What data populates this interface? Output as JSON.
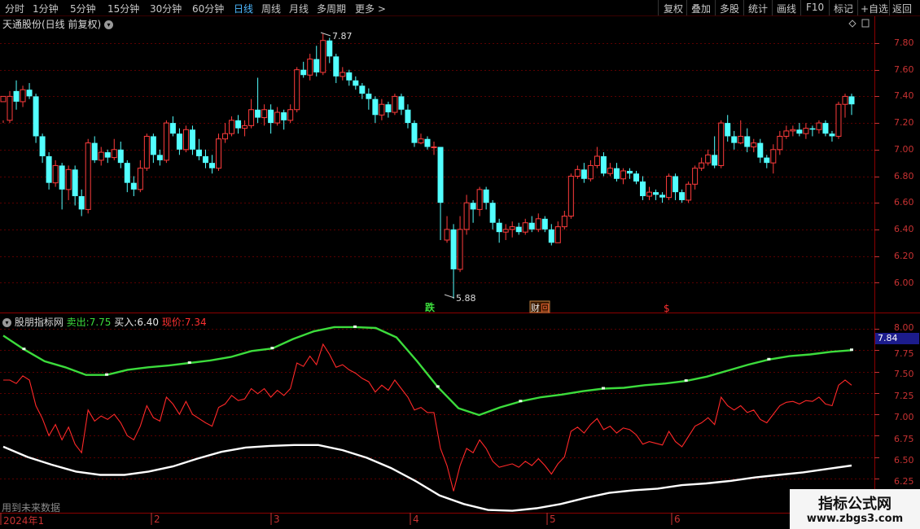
{
  "toolbar": {
    "periods": [
      "分时",
      "1分钟",
      "5分钟",
      "15分钟",
      "30分钟",
      "60分钟",
      "日线",
      "周线",
      "月线",
      "多周期",
      "更多"
    ],
    "active_period": "日线",
    "more_arrow": ">",
    "right_buttons": [
      "复权",
      "叠加",
      "多股",
      "统计",
      "画线",
      "F10",
      "标记",
      "+自选",
      "返回"
    ]
  },
  "chart": {
    "title": "天通股份(日线 前复权)",
    "high_mark": "7.87",
    "low_mark": "5.88",
    "event_labels": [
      "跌",
      "财",
      "回",
      "$"
    ],
    "price_ticks": [
      "7.80",
      "7.60",
      "7.40",
      "7.20",
      "7.00",
      "6.80",
      "6.60",
      "6.40",
      "6.20",
      "6.00"
    ]
  },
  "indicator": {
    "name": "股朋指标网",
    "sell_label": "卖出:",
    "sell_value": "7.75",
    "buy_label": "买入:",
    "buy_value": "6.40",
    "price_label": "现价:",
    "price_value": "7.34",
    "current_box": "7.84",
    "ticks": [
      "8.00",
      "7.75",
      "7.50",
      "7.25",
      "7.00",
      "6.75",
      "6.50",
      "6.25"
    ]
  },
  "date_axis": [
    "2024年1",
    "2",
    "3",
    "4",
    "5",
    "6"
  ],
  "footer_note": "用到未来数据",
  "watermark": {
    "title": "指标公式网",
    "url": "www.zbgs3.com"
  },
  "colors": {
    "up": "#ff3c3c",
    "down": "#52ffff",
    "sell_line": "#3cdc3c",
    "buy_line": "#ffffff",
    "price_line": "#ff2828",
    "active": "#4db8ff"
  },
  "chart_data": {
    "type": "candlestick",
    "price_range": [
      5.88,
      7.87
    ],
    "candles": [
      [
        7.36,
        7.4,
        7.22,
        7.2
      ],
      [
        7.22,
        7.4,
        7.44,
        7.2
      ],
      [
        7.44,
        7.36,
        7.52,
        7.3
      ],
      [
        7.36,
        7.45,
        7.48,
        7.32
      ],
      [
        7.45,
        7.4,
        7.5,
        7.38
      ],
      [
        7.4,
        7.1,
        7.42,
        7.05
      ],
      [
        7.1,
        6.95,
        7.12,
        6.9
      ],
      [
        6.95,
        6.75,
        6.98,
        6.7
      ],
      [
        6.75,
        6.88,
        6.92,
        6.72
      ],
      [
        6.88,
        6.7,
        6.9,
        6.55
      ],
      [
        6.7,
        6.85,
        6.88,
        6.62
      ],
      [
        6.85,
        6.65,
        6.88,
        6.58
      ],
      [
        6.65,
        6.55,
        6.7,
        6.5
      ],
      [
        6.55,
        7.05,
        7.08,
        6.52
      ],
      [
        7.05,
        6.92,
        7.1,
        6.9
      ],
      [
        6.92,
        6.98,
        7.02,
        6.88
      ],
      [
        6.98,
        6.94,
        7.0,
        6.9
      ],
      [
        6.94,
        7.0,
        7.08,
        6.92
      ],
      [
        7.0,
        6.9,
        7.06,
        6.86
      ],
      [
        6.9,
        6.75,
        6.92,
        6.68
      ],
      [
        6.75,
        6.7,
        6.8,
        6.65
      ],
      [
        6.7,
        6.86,
        6.92,
        6.68
      ],
      [
        6.86,
        7.1,
        7.12,
        6.84
      ],
      [
        7.1,
        6.96,
        7.12,
        6.9
      ],
      [
        6.96,
        6.92,
        7.0,
        6.88
      ],
      [
        6.92,
        7.2,
        7.22,
        6.9
      ],
      [
        7.2,
        7.12,
        7.25,
        7.1
      ],
      [
        7.12,
        7.0,
        7.16,
        6.96
      ],
      [
        7.0,
        7.15,
        7.18,
        6.98
      ],
      [
        7.15,
        7.0,
        7.18,
        6.96
      ],
      [
        7.0,
        6.95,
        7.08,
        6.92
      ],
      [
        6.95,
        6.9,
        7.0,
        6.86
      ],
      [
        6.9,
        6.86,
        6.96,
        6.82
      ],
      [
        6.86,
        7.08,
        7.12,
        6.84
      ],
      [
        7.08,
        7.12,
        7.2,
        7.05
      ],
      [
        7.12,
        7.22,
        7.25,
        7.1
      ],
      [
        7.22,
        7.16,
        7.26,
        7.12
      ],
      [
        7.16,
        7.18,
        7.22,
        7.1
      ],
      [
        7.18,
        7.3,
        7.38,
        7.16
      ],
      [
        7.3,
        7.24,
        7.54,
        7.2
      ],
      [
        7.24,
        7.3,
        7.34,
        7.18
      ],
      [
        7.3,
        7.2,
        7.34,
        7.12
      ],
      [
        7.2,
        7.28,
        7.32,
        7.18
      ],
      [
        7.28,
        7.22,
        7.3,
        7.15
      ],
      [
        7.22,
        7.3,
        7.34,
        7.2
      ],
      [
        7.3,
        7.6,
        7.62,
        7.28
      ],
      [
        7.6,
        7.56,
        7.66,
        7.54
      ],
      [
        7.56,
        7.68,
        7.72,
        7.52
      ],
      [
        7.68,
        7.58,
        7.78,
        7.55
      ],
      [
        7.58,
        7.82,
        7.87,
        7.56
      ],
      [
        7.82,
        7.7,
        7.84,
        7.65
      ],
      [
        7.7,
        7.55,
        7.72,
        7.5
      ],
      [
        7.55,
        7.58,
        7.62,
        7.52
      ],
      [
        7.58,
        7.52,
        7.6,
        7.48
      ],
      [
        7.52,
        7.48,
        7.55,
        7.45
      ],
      [
        7.48,
        7.42,
        7.5,
        7.38
      ],
      [
        7.42,
        7.38,
        7.46,
        7.3
      ],
      [
        7.38,
        7.26,
        7.4,
        7.2
      ],
      [
        7.26,
        7.34,
        7.38,
        7.22
      ],
      [
        7.34,
        7.28,
        7.36,
        7.24
      ],
      [
        7.28,
        7.4,
        7.42,
        7.26
      ],
      [
        7.4,
        7.3,
        7.42,
        7.26
      ],
      [
        7.3,
        7.2,
        7.34,
        7.16
      ],
      [
        7.2,
        7.05,
        7.22,
        7.02
      ],
      [
        7.05,
        7.08,
        7.12,
        7.04
      ],
      [
        7.08,
        7.02,
        7.1,
        7.0
      ],
      [
        7.02,
        7.02,
        7.06,
        6.96
      ],
      [
        7.02,
        6.6,
        6.72,
        6.32
      ],
      [
        6.32,
        6.4,
        6.5,
        6.3
      ],
      [
        6.4,
        6.1,
        6.44,
        5.88
      ],
      [
        6.1,
        6.4,
        6.5,
        6.08
      ],
      [
        6.4,
        6.6,
        6.66,
        6.36
      ],
      [
        6.6,
        6.55,
        6.62,
        6.45
      ],
      [
        6.55,
        6.7,
        6.72,
        6.5
      ],
      [
        6.7,
        6.6,
        6.72,
        6.55
      ],
      [
        6.6,
        6.45,
        6.62,
        6.4
      ],
      [
        6.45,
        6.38,
        6.48,
        6.3
      ],
      [
        6.38,
        6.4,
        6.44,
        6.32
      ],
      [
        6.4,
        6.42,
        6.46,
        6.34
      ],
      [
        6.42,
        6.38,
        6.45,
        6.36
      ],
      [
        6.38,
        6.45,
        6.48,
        6.36
      ],
      [
        6.45,
        6.4,
        6.5,
        6.38
      ],
      [
        6.4,
        6.48,
        6.52,
        6.38
      ],
      [
        6.48,
        6.4,
        6.5,
        6.38
      ],
      [
        6.4,
        6.3,
        6.44,
        6.28
      ],
      [
        6.3,
        6.42,
        6.46,
        6.3
      ],
      [
        6.42,
        6.5,
        6.54,
        6.4
      ],
      [
        6.5,
        6.8,
        6.82,
        6.48
      ],
      [
        6.8,
        6.85,
        6.88,
        6.78
      ],
      [
        6.85,
        6.78,
        6.9,
        6.75
      ],
      [
        6.78,
        6.88,
        6.92,
        6.76
      ],
      [
        6.88,
        6.95,
        7.02,
        6.86
      ],
      [
        6.95,
        6.82,
        6.98,
        6.8
      ],
      [
        6.82,
        6.86,
        6.9,
        6.8
      ],
      [
        6.86,
        6.78,
        6.9,
        6.76
      ],
      [
        6.78,
        6.84,
        6.86,
        6.74
      ],
      [
        6.84,
        6.82,
        6.86,
        6.78
      ],
      [
        6.82,
        6.76,
        6.84,
        6.74
      ],
      [
        6.76,
        6.65,
        6.8,
        6.62
      ],
      [
        6.65,
        6.68,
        6.72,
        6.62
      ],
      [
        6.68,
        6.66,
        6.7,
        6.62
      ],
      [
        6.66,
        6.64,
        6.68,
        6.6
      ],
      [
        6.64,
        6.8,
        6.82,
        6.62
      ],
      [
        6.8,
        6.68,
        6.82,
        6.62
      ],
      [
        6.68,
        6.62,
        6.7,
        6.6
      ],
      [
        6.62,
        6.74,
        6.76,
        6.6
      ],
      [
        6.74,
        6.86,
        6.88,
        6.7
      ],
      [
        6.86,
        6.9,
        6.94,
        6.84
      ],
      [
        6.9,
        6.96,
        7.0,
        6.88
      ],
      [
        6.96,
        6.88,
        7.1,
        6.86
      ],
      [
        6.88,
        7.2,
        7.22,
        6.86
      ],
      [
        7.2,
        7.1,
        7.26,
        7.06
      ],
      [
        7.1,
        7.05,
        7.14,
        7.0
      ],
      [
        7.05,
        7.1,
        7.22,
        7.04
      ],
      [
        7.1,
        7.02,
        7.16,
        6.98
      ],
      [
        7.02,
        7.05,
        7.08,
        6.98
      ],
      [
        7.05,
        6.94,
        7.08,
        6.9
      ],
      [
        6.94,
        6.9,
        6.96,
        6.86
      ],
      [
        6.9,
        7.0,
        7.04,
        6.82
      ],
      [
        7.0,
        7.1,
        7.14,
        6.96
      ],
      [
        7.1,
        7.14,
        7.18,
        7.08
      ],
      [
        7.14,
        7.15,
        7.18,
        7.1
      ],
      [
        7.15,
        7.12,
        7.2,
        7.1
      ],
      [
        7.12,
        7.16,
        7.2,
        7.08
      ],
      [
        7.16,
        7.15,
        7.18,
        7.1
      ],
      [
        7.15,
        7.2,
        7.22,
        7.12
      ],
      [
        7.2,
        7.12,
        7.22,
        7.1
      ],
      [
        7.12,
        7.1,
        7.14,
        7.06
      ],
      [
        7.1,
        7.34,
        7.36,
        7.08
      ],
      [
        7.34,
        7.4,
        7.42,
        7.24
      ],
      [
        7.4,
        7.34,
        7.42,
        7.26
      ]
    ],
    "sell_line": [
      7.92,
      7.76,
      7.62,
      7.55,
      7.46,
      7.46,
      7.52,
      7.55,
      7.57,
      7.6,
      7.63,
      7.67,
      7.74,
      7.77,
      7.88,
      7.97,
      8.02,
      8.02,
      8.01,
      7.9,
      7.62,
      7.32,
      7.07,
      6.99,
      7.08,
      7.15,
      7.2,
      7.23,
      7.27,
      7.3,
      7.31,
      7.34,
      7.36,
      7.39,
      7.44,
      7.51,
      7.58,
      7.64,
      7.68,
      7.7,
      7.73,
      7.75
    ],
    "buy_line": [
      6.62,
      6.5,
      6.41,
      6.33,
      6.29,
      6.29,
      6.33,
      6.39,
      6.48,
      6.56,
      6.61,
      6.63,
      6.64,
      6.64,
      6.58,
      6.49,
      6.37,
      6.22,
      6.05,
      5.95,
      5.88,
      5.87,
      5.9,
      5.95,
      6.02,
      6.08,
      6.11,
      6.13,
      6.17,
      6.19,
      6.22,
      6.26,
      6.29,
      6.32,
      6.36,
      6.4
    ]
  }
}
